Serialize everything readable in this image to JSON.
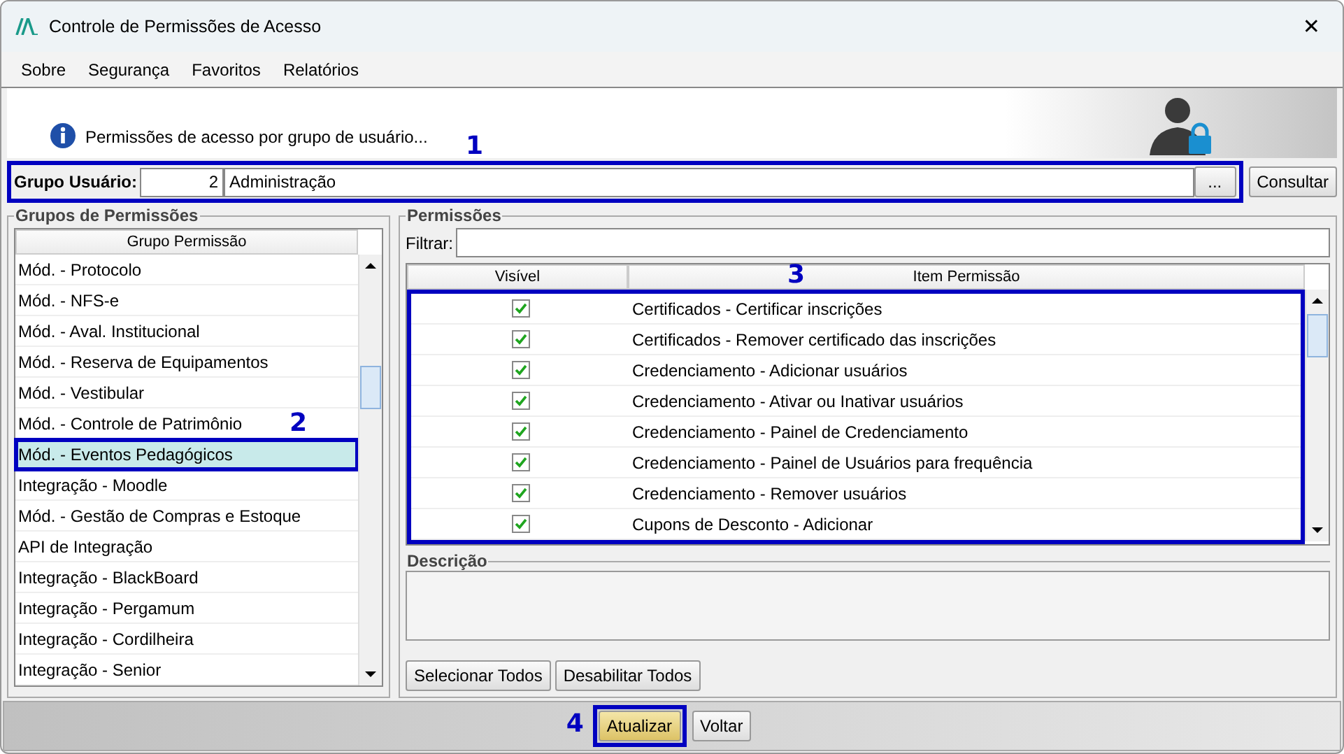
{
  "window": {
    "title": "Controle de Permissões de Acesso",
    "close": "✕"
  },
  "menu": [
    "Sobre",
    "Segurança",
    "Favoritos",
    "Relatórios"
  ],
  "header": {
    "info": "Permissões de acesso por grupo de usuário..."
  },
  "group_user": {
    "label": "Grupo Usuário:",
    "code": "2",
    "name": "Administração",
    "browse": "...",
    "search_button": "Consultar"
  },
  "groups_panel": {
    "title": "Grupos de Permissões",
    "column": "Grupo Permissão",
    "rows": [
      {
        "name": "Mód. - Protocolo",
        "selected": false
      },
      {
        "name": "Mód. - NFS-e",
        "selected": false
      },
      {
        "name": "Mód. - Aval. Institucional",
        "selected": false
      },
      {
        "name": "Mód. - Reserva de Equipamentos",
        "selected": false
      },
      {
        "name": "Mód. - Vestibular",
        "selected": false
      },
      {
        "name": "Mód. - Controle de Patrimônio",
        "selected": false
      },
      {
        "name": "Mód. - Eventos Pedagógicos",
        "selected": true
      },
      {
        "name": "Integração - Moodle",
        "selected": false
      },
      {
        "name": "Mód. - Gestão de Compras e Estoque",
        "selected": false
      },
      {
        "name": "API de Integração",
        "selected": false
      },
      {
        "name": "Integração - BlackBoard",
        "selected": false
      },
      {
        "name": "Integração - Pergamum",
        "selected": false
      },
      {
        "name": "Integração - Cordilheira",
        "selected": false
      },
      {
        "name": "Integração - Senior",
        "selected": false
      }
    ]
  },
  "permissions_panel": {
    "title": "Permissões",
    "filter_label": "Filtrar:",
    "columns": [
      "Visível",
      "Item Permissão"
    ],
    "rows": [
      {
        "checked": true,
        "item": "Certificados - Certificar inscrições"
      },
      {
        "checked": true,
        "item": "Certificados - Remover certificado das inscrições"
      },
      {
        "checked": true,
        "item": "Credenciamento - Adicionar usuários"
      },
      {
        "checked": true,
        "item": "Credenciamento - Ativar ou Inativar usuários"
      },
      {
        "checked": true,
        "item": "Credenciamento - Painel de Credenciamento"
      },
      {
        "checked": true,
        "item": "Credenciamento - Painel de Usuários para frequência"
      },
      {
        "checked": true,
        "item": "Credenciamento - Remover usuários"
      },
      {
        "checked": true,
        "item": "Cupons de Desconto - Adicionar"
      }
    ],
    "description_title": "Descrição",
    "buttons": [
      "Selecionar Todos",
      "Desabilitar Todos"
    ]
  },
  "footer": {
    "buttons": [
      {
        "label": "Atualizar",
        "kind": "primary"
      },
      {
        "label": "Voltar",
        "kind": "normal"
      }
    ]
  },
  "annotations": [
    "1",
    "2",
    "3",
    "4"
  ]
}
